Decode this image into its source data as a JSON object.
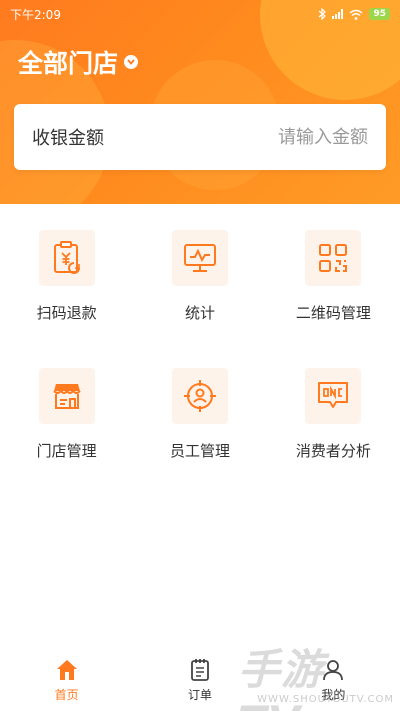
{
  "status_bar": {
    "time": "下午2:09",
    "battery": "95"
  },
  "header": {
    "store_title": "全部门店",
    "dropdown_icon": "chevron-down-icon"
  },
  "amount": {
    "label": "收银金额",
    "placeholder": "请输入金额"
  },
  "grid": {
    "items": [
      {
        "label": "扫码退款",
        "icon": "scan-refund-icon"
      },
      {
        "label": "统计",
        "icon": "statistics-monitor-icon"
      },
      {
        "label": "二维码管理",
        "icon": "qrcode-icon"
      },
      {
        "label": "门店管理",
        "icon": "store-icon"
      },
      {
        "label": "员工管理",
        "icon": "staff-icon"
      },
      {
        "label": "消费者分析",
        "icon": "consumer-analysis-icon"
      }
    ]
  },
  "tabbar": {
    "tabs": [
      {
        "label": "首页",
        "icon": "home-icon",
        "active": true
      },
      {
        "label": "订单",
        "icon": "order-icon",
        "active": false
      },
      {
        "label": "我的",
        "icon": "user-icon",
        "active": false
      }
    ]
  },
  "colors": {
    "accent": "#ff7a1f",
    "icon_bg": "#fef3ea"
  },
  "watermark": {
    "main": "手游TV",
    "sub": "WWW.SHOUYOUTV.COM"
  }
}
